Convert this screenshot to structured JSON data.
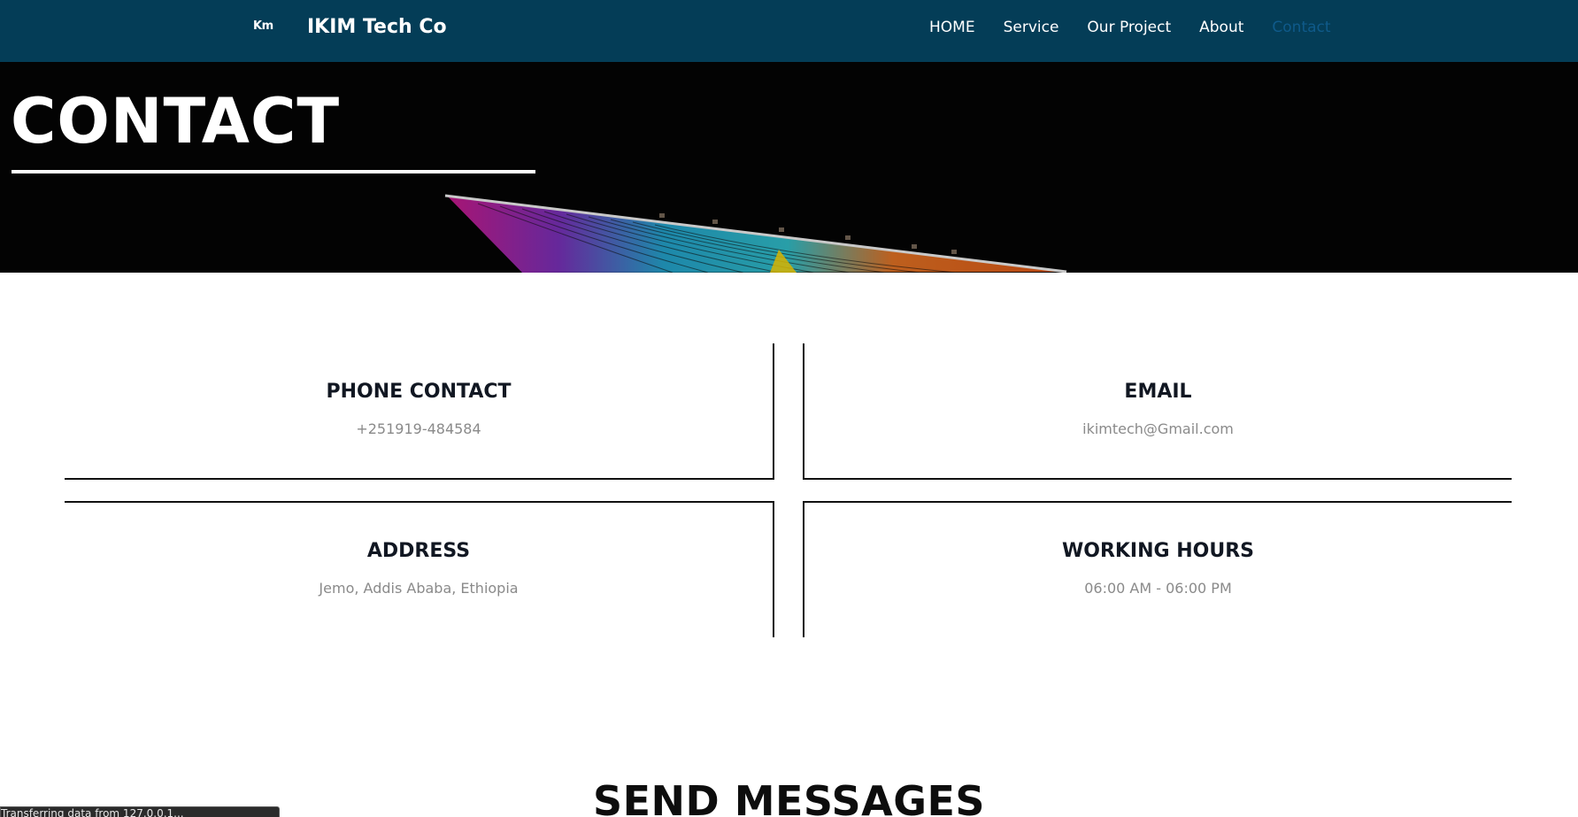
{
  "navbar": {
    "logo_text": "Km",
    "brand": "IKIM Tech Co",
    "links": [
      "HOME",
      "Service",
      "Our Project",
      "About",
      "Contact"
    ],
    "active_link": "Contact",
    "background_color": "#043d57",
    "active_color": "#0f5a8a"
  },
  "hero": {
    "title": "CONTACT"
  },
  "info": {
    "phone": {
      "title": "PHONE CONTACT",
      "value": "+251919-484584"
    },
    "email": {
      "title": "EMAIL",
      "value": "ikimtech@Gmail.com"
    },
    "address": {
      "title": "ADDRESS",
      "value": "Jemo, Addis Ababa, Ethiopia"
    },
    "hours": {
      "title": "WORKING HOURS",
      "value": "06:00 AM - 06:00 PM"
    }
  },
  "send_section": {
    "title": "SEND MESSAGES"
  },
  "status_bar": {
    "text": "Transferring data from 127.0.0.1..."
  }
}
